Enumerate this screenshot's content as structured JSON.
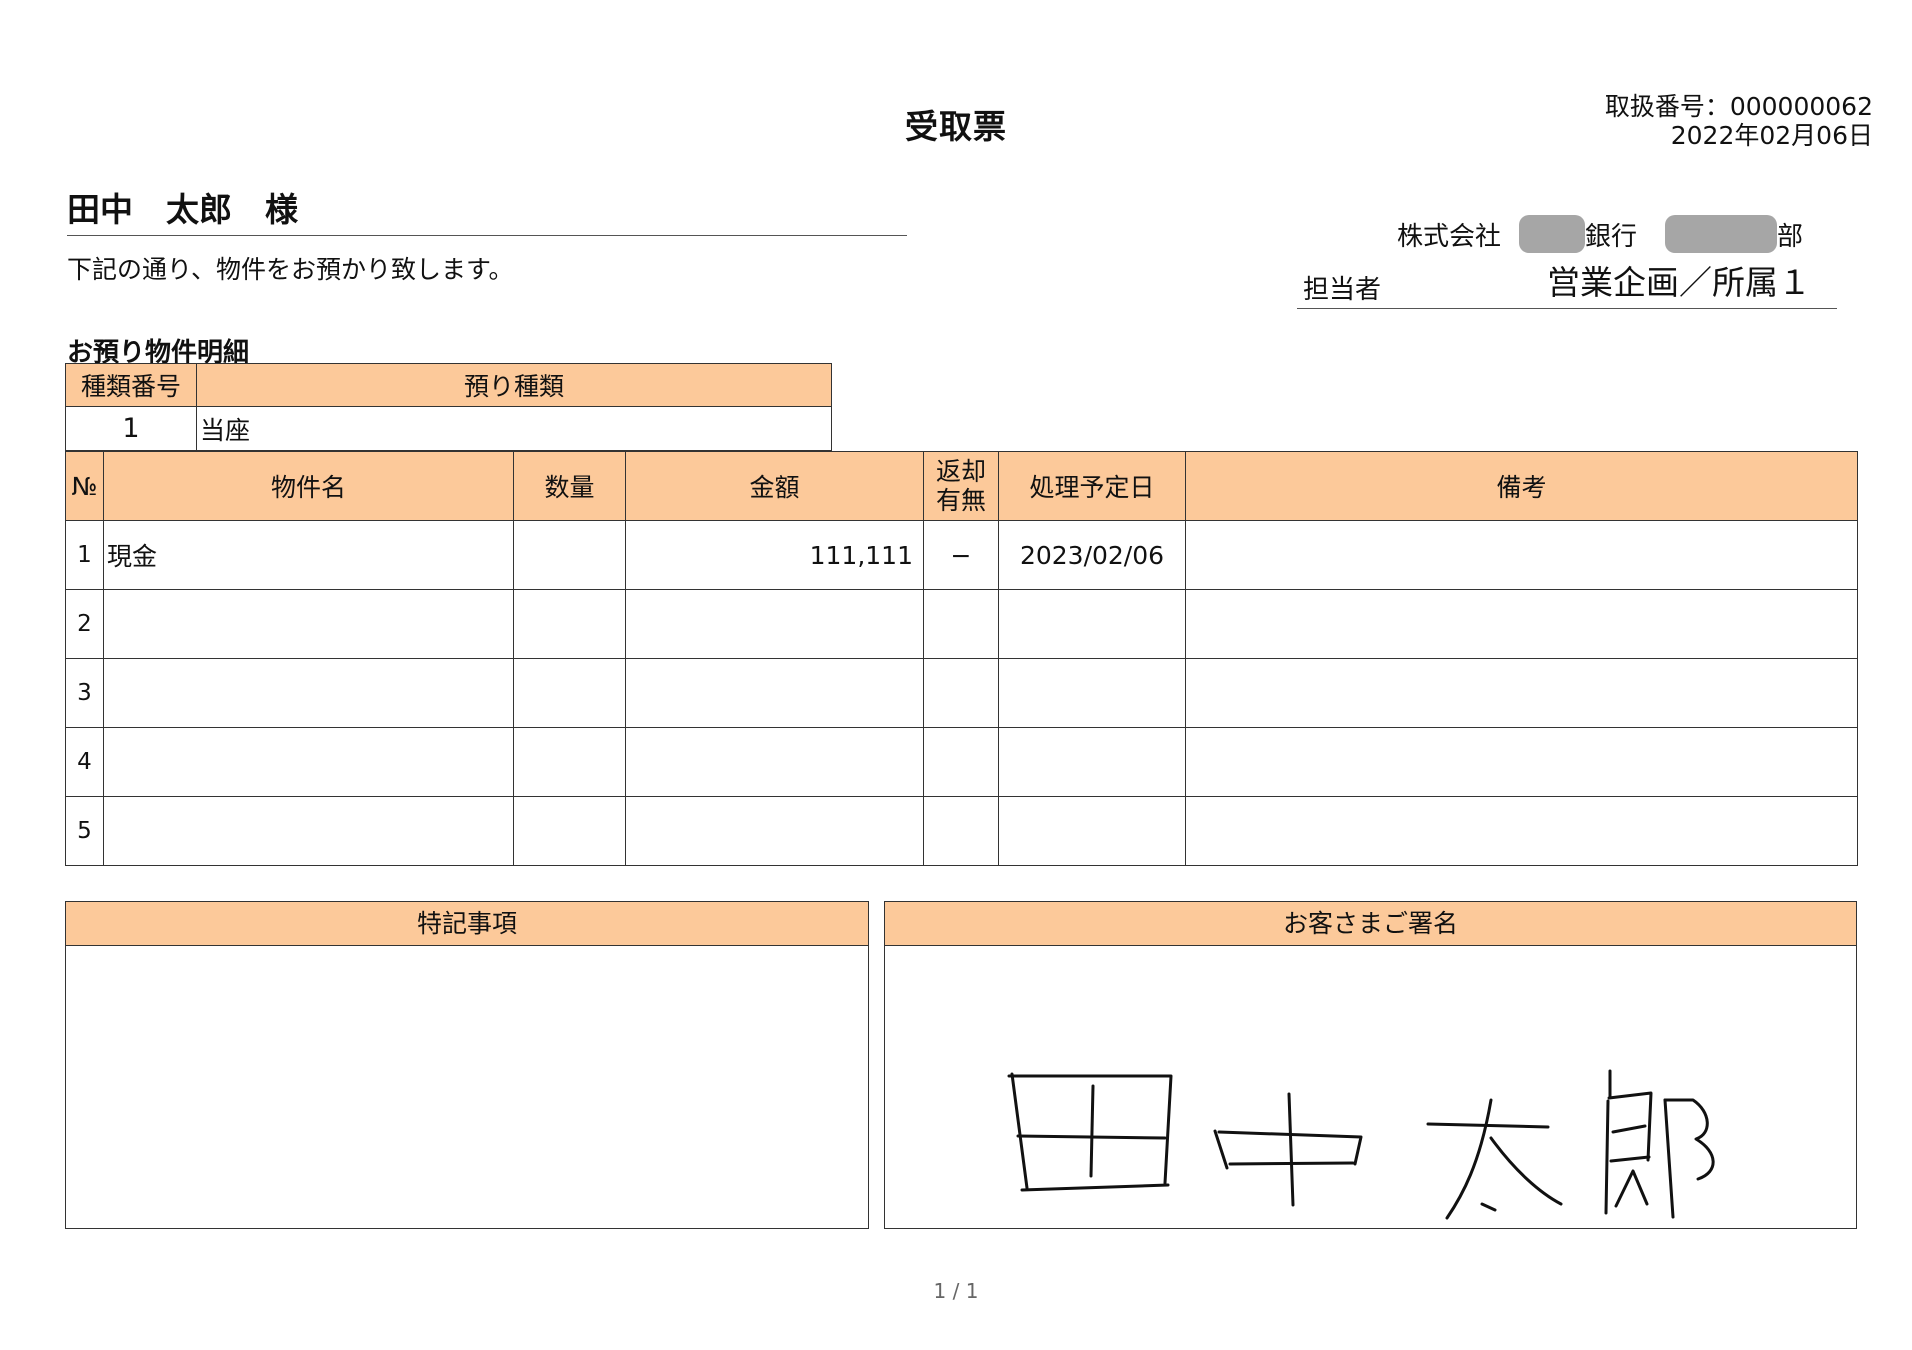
{
  "document": {
    "title": "受取票",
    "handling_number": "取扱番号：000000062",
    "date": "2022年02月06日",
    "customer": "田中　太郎　様",
    "intro": "下記の通り、物件をお預かり致します。",
    "company_prefix": "株式会社",
    "bank_suffix": "銀行",
    "dept_suffix": "部",
    "staff_label": "担当者",
    "staff_name": "営業企画／所属１",
    "section_title": "お預り物件明細",
    "page_indicator": "1 / 1"
  },
  "type_table": {
    "headers": [
      "種類番号",
      "預り種類"
    ],
    "row": {
      "number": "1",
      "type": "当座"
    }
  },
  "items_table": {
    "headers": [
      "№",
      "物件名",
      "数量",
      "金額",
      "返却",
      "有無",
      "処理予定日",
      "備考"
    ],
    "rows": [
      {
        "no": "1",
        "name": "現金",
        "qty": "",
        "amount": "111,111",
        "returned": "−",
        "date": "2023/02/06",
        "remarks": ""
      },
      {
        "no": "2",
        "name": "",
        "qty": "",
        "amount": "",
        "returned": "",
        "date": "",
        "remarks": ""
      },
      {
        "no": "3",
        "name": "",
        "qty": "",
        "amount": "",
        "returned": "",
        "date": "",
        "remarks": ""
      },
      {
        "no": "4",
        "name": "",
        "qty": "",
        "amount": "",
        "returned": "",
        "date": "",
        "remarks": ""
      },
      {
        "no": "5",
        "name": "",
        "qty": "",
        "amount": "",
        "returned": "",
        "date": "",
        "remarks": ""
      }
    ]
  },
  "notes_box": {
    "header": "特記事項",
    "content": ""
  },
  "signature_box": {
    "header": "お客さまご署名",
    "signature_text": "田中太郎",
    "signature_kind": "handwritten-signature"
  },
  "colors": {
    "header_fill": "#fcc99a",
    "redaction": "#a6a6a6"
  }
}
